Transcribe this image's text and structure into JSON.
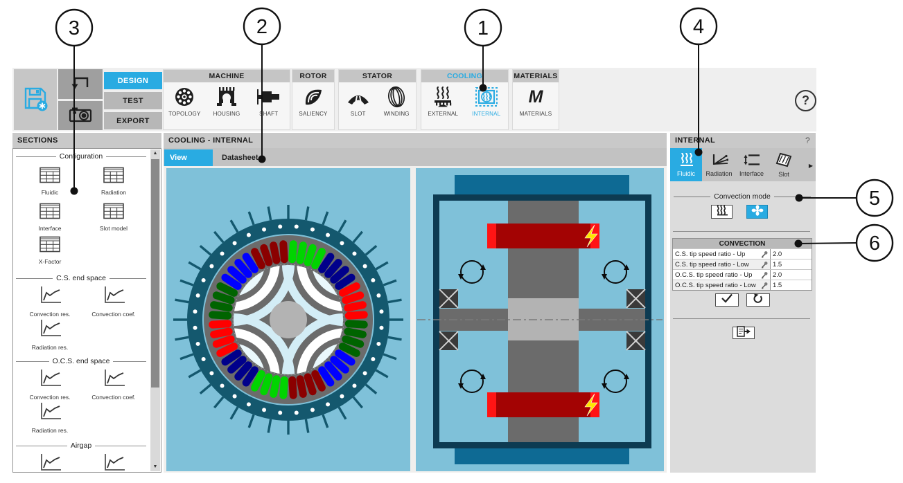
{
  "callouts": [
    "1",
    "2",
    "3",
    "4",
    "5",
    "6"
  ],
  "toolbar": {
    "design_label": "DESIGN",
    "test_label": "TEST",
    "export_label": "EXPORT",
    "help_label": "?",
    "groups": [
      {
        "title": "MACHINE",
        "items": [
          "TOPOLOGY",
          "HOUSING",
          "SHAFT"
        ]
      },
      {
        "title": "ROTOR",
        "items": [
          "SALIENCY"
        ]
      },
      {
        "title": "STATOR",
        "items": [
          "SLOT",
          "WINDING"
        ]
      },
      {
        "title": "COOLING",
        "items": [
          "EXTERNAL",
          "INTERNAL"
        ],
        "active_item": "INTERNAL"
      },
      {
        "title": "MATERIALS",
        "items": [
          "MATERIALS"
        ]
      }
    ]
  },
  "sections_panel": {
    "title": "SECTIONS",
    "groups": [
      {
        "legend": "Configuration",
        "items": [
          "Fluidic",
          "Radiation",
          "Interface",
          "Slot model",
          "X-Factor"
        ]
      },
      {
        "legend": "C.S. end space",
        "items": [
          "Convection res.",
          "Convection coef.",
          "Radiation res."
        ]
      },
      {
        "legend": "O.C.S. end space",
        "items": [
          "Convection res.",
          "Convection coef.",
          "Radiation res."
        ]
      },
      {
        "legend": "Airgap",
        "items": []
      }
    ]
  },
  "main_panel": {
    "title": "COOLING - INTERNAL",
    "tabs": [
      "View",
      "Datasheet"
    ],
    "active_tab": "View"
  },
  "right_panel": {
    "title": "INTERNAL",
    "help_label": "?",
    "tabs": [
      "Fluidic",
      "Radiation",
      "Interface",
      "Slot"
    ],
    "active_tab": "Fluidic",
    "more_tabs_arrow": "▶",
    "convection_mode_label": "Convection mode",
    "table": {
      "header": "CONVECTION",
      "rows": [
        {
          "label": "C.S. tip speed ratio - Up",
          "value": "2.0"
        },
        {
          "label": "C.S. tip speed ratio - Low",
          "value": "1.5"
        },
        {
          "label": "O.C.S. tip speed ratio - Up",
          "value": "2.0"
        },
        {
          "label": "O.C.S. tip speed ratio - Low",
          "value": "1.5"
        }
      ]
    }
  },
  "icons": {
    "save-icon": "floppy-disk with asterisk badge",
    "undo-icon": "return arrow",
    "camera-icon": "camera",
    "help-icon": "question mark in circle",
    "convection-natural-icon": "heat waves",
    "convection-forced-icon": "fan",
    "apply-icon": "checkmark",
    "reset-icon": "circular arrow",
    "export-icon": "document with arrow"
  },
  "colors": {
    "accent_blue": "#29abe2",
    "housing_teal": "#14586e",
    "view_background": "#7fc1d9",
    "frame_navy": "#0d3b52",
    "winding_red": "#ff1414",
    "winding_dark_red": "#a30303",
    "bolt_yellow": "#ffe400"
  }
}
